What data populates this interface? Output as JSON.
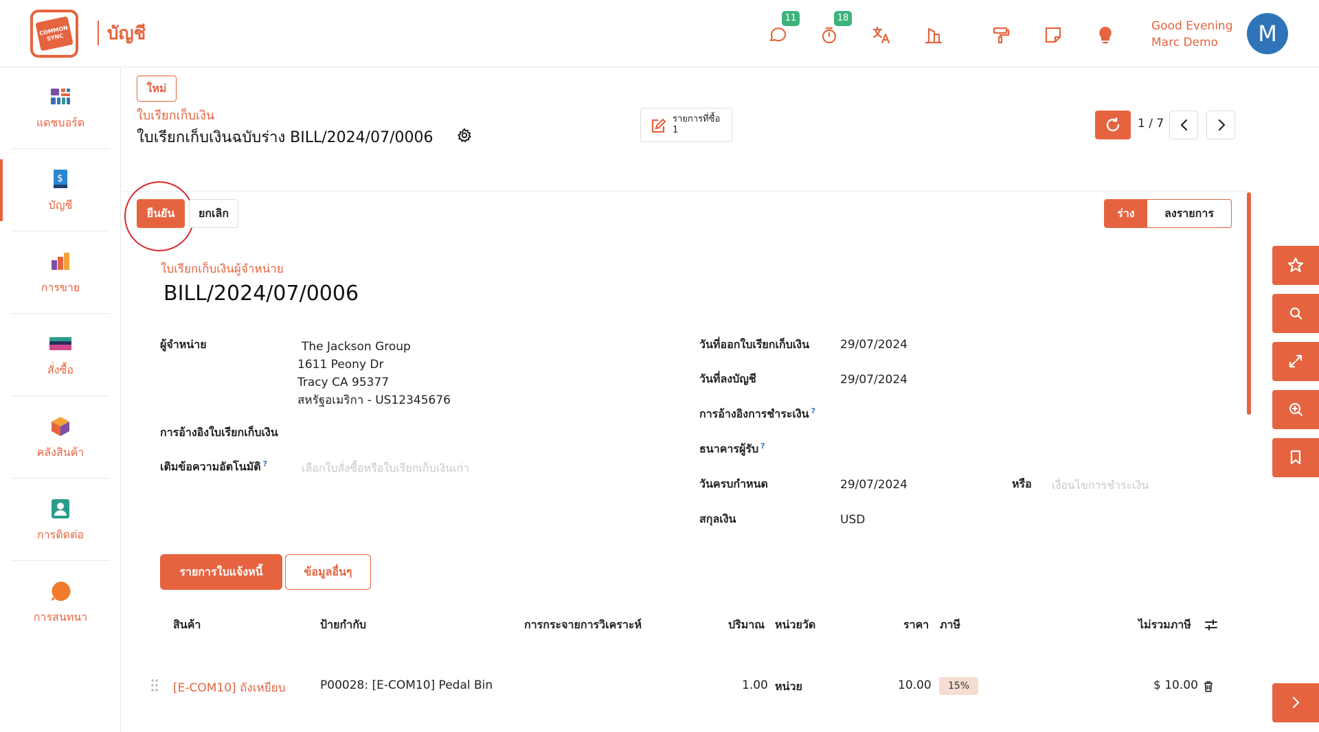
{
  "app": {
    "title": "บัญชี",
    "logo_text": "COMMON SYNC"
  },
  "topbar": {
    "messages_badge": "11",
    "activities_badge": "18",
    "greeting_line1": "Good Evening",
    "greeting_line2": "Marc Demo",
    "avatar_initial": "M"
  },
  "sidebar": {
    "items": [
      {
        "label": "แดชบอร์ด",
        "icon": "dashboard-icon"
      },
      {
        "label": "บัญชี",
        "icon": "accounting-icon"
      },
      {
        "label": "การขาย",
        "icon": "sales-icon"
      },
      {
        "label": "สั่งซื้อ",
        "icon": "purchase-icon"
      },
      {
        "label": "คลังสินค้า",
        "icon": "inventory-icon"
      },
      {
        "label": "การติดต่อ",
        "icon": "contacts-icon"
      },
      {
        "label": "การสนทนา",
        "icon": "discuss-icon"
      }
    ]
  },
  "header": {
    "new_label": "ใหม่",
    "breadcrumb_parent": "ใบเรียกเก็บเงิน",
    "breadcrumb_current": "ใบเรียกเก็บเงินฉบับร่าง BILL/2024/07/0006",
    "smart_button_label": "รายการที่ซื้อ",
    "smart_button_count": "1",
    "pager_value": "1 / 7"
  },
  "actions": {
    "confirm_label": "ยืนยัน",
    "cancel_label": "ยกเลิก",
    "status_draft": "ร่าง",
    "status_posted": "ลงรายการ"
  },
  "form": {
    "doc_type": "ใบเรียกเก็บเงินผู้จำหน่าย",
    "doc_number": "BILL/2024/07/0006",
    "vendor_label": "ผู้จำหน่าย",
    "vendor_name": "The Jackson Group",
    "vendor_street": "1611 Peony Dr",
    "vendor_city": "Tracy CA 95377",
    "vendor_country": "สหรัฐอเมริกา - US12345676",
    "bill_reference_label": "การอ้างอิงใบเรียกเก็บเงิน",
    "auto_complete_label": "เติมข้อความอัตโนมัติ",
    "auto_complete_placeholder": "เลือกใบสั่งซื้อหรือใบเรียกเก็บเงินเก่า",
    "bill_date_label": "วันที่ออกใบเรียกเก็บเงิน",
    "bill_date_value": "29/07/2024",
    "accounting_date_label": "วันที่ลงบัญชี",
    "accounting_date_value": "29/07/2024",
    "payment_reference_label": "การอ้างอิงการชำระเงิน",
    "recipient_bank_label": "ธนาคารผู้รับ",
    "due_date_label": "วันครบกำหนด",
    "due_date_value": "29/07/2024",
    "or_label": "หรือ",
    "payment_terms_placeholder": "เงื่อนไขการชำระเงิน",
    "currency_label": "สกุลเงิน",
    "currency_value": "USD",
    "help_mark": "?"
  },
  "tabs": {
    "invoice_lines": "รายการใบแจ้งหนี้",
    "other_info": "ข้อมูลอื่นๆ"
  },
  "table": {
    "headers": {
      "product": "สินค้า",
      "label": "ป้ายกำกับ",
      "analytic": "การกระจายการวิเคราะห์",
      "quantity": "ปริมาณ",
      "uom": "หน่วยวัด",
      "price": "ราคา",
      "tax": "ภาษี",
      "subtotal": "ไม่รวมภาษี"
    },
    "rows": [
      {
        "product": "[E-COM10] ถังเหยียบ",
        "label": "P00028: [E-COM10] Pedal Bin",
        "quantity": "1.00",
        "uom": "หน่วย",
        "price": "10.00",
        "tax": "15%",
        "subtotal": "$ 10.00"
      }
    ]
  },
  "colors": {
    "accent": "#e5643f",
    "badge": "#3db37c",
    "avatar": "#2f74b8",
    "highlight": "#d8272d"
  }
}
